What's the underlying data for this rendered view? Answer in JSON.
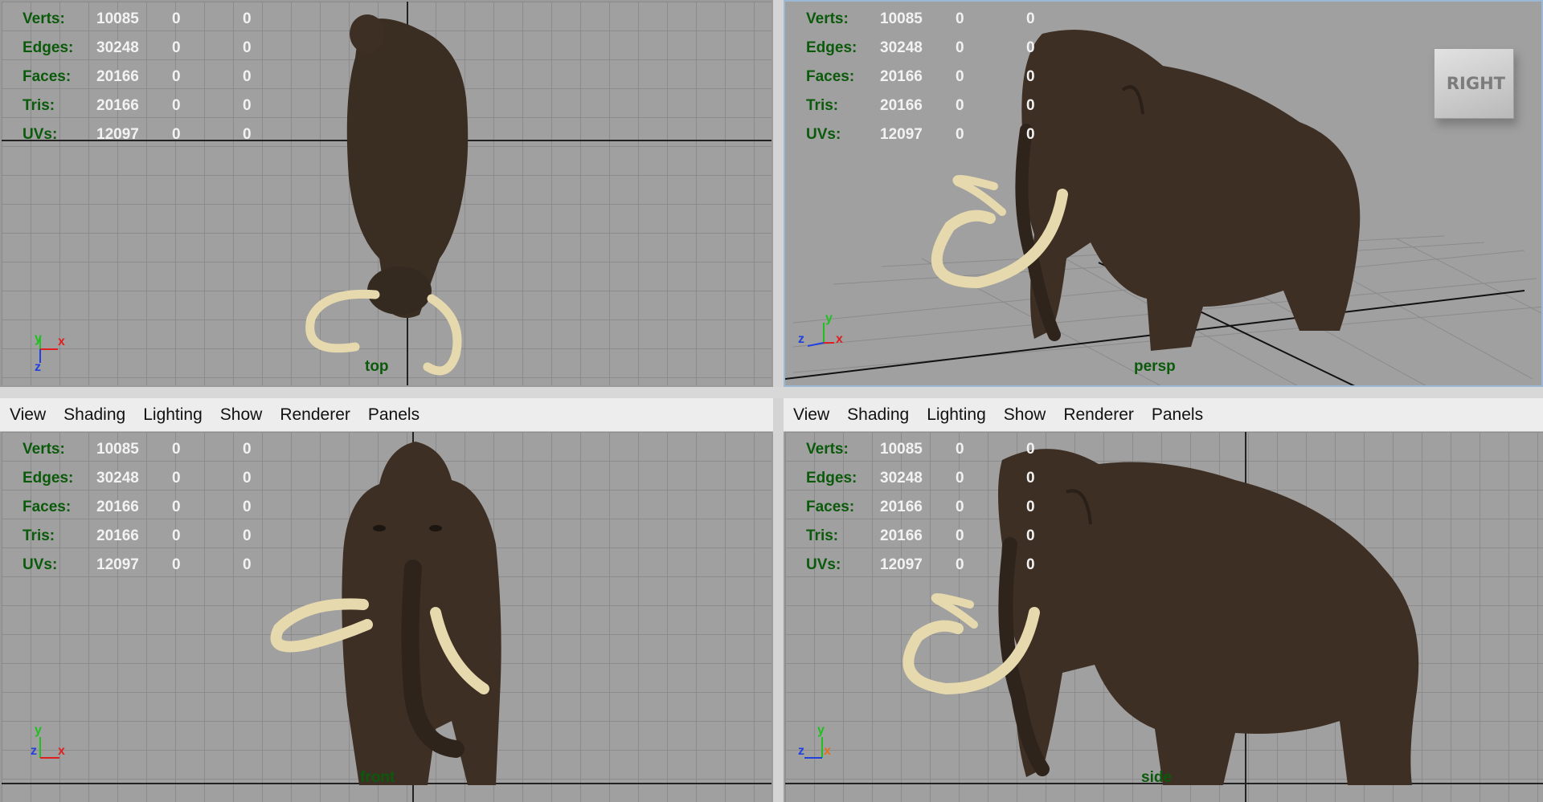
{
  "stats": {
    "labels": [
      "Verts:",
      "Edges:",
      "Faces:",
      "Tris:",
      "UVs:"
    ],
    "rows": [
      {
        "label": "Verts:",
        "v1": "10085",
        "v2": "0",
        "v3": "0"
      },
      {
        "label": "Edges:",
        "v1": "30248",
        "v2": "0",
        "v3": "0"
      },
      {
        "label": "Faces:",
        "v1": "20166",
        "v2": "0",
        "v3": "0"
      },
      {
        "label": "Tris:",
        "v1": "20166",
        "v2": "0",
        "v3": "0"
      },
      {
        "label": "UVs:",
        "v1": "12097",
        "v2": "0",
        "v3": "0"
      }
    ]
  },
  "viewports": {
    "top": {
      "camera": "top",
      "axes": {
        "a": "y",
        "b": "x",
        "c": "z"
      }
    },
    "persp": {
      "camera": "persp",
      "axes": {
        "a": "y",
        "b": "z",
        "c": "x"
      },
      "viewcube": "RIGHT"
    },
    "front": {
      "camera": "front",
      "axes": {
        "a": "y",
        "b": "z",
        "c": "x"
      }
    },
    "side": {
      "camera": "side",
      "axes": {
        "a": "y",
        "b": "z",
        "c": "x"
      }
    }
  },
  "menus": {
    "left": [
      "View",
      "Shading",
      "Lighting",
      "Show",
      "Renderer",
      "Panels"
    ],
    "right": [
      "View",
      "Shading",
      "Lighting",
      "Show",
      "Renderer",
      "Panels"
    ]
  },
  "colors": {
    "hud_label": "#0b5a0b",
    "viewport_bg": "#a0a0a0",
    "grid_line": "#8b8b8b",
    "fur": "#3e2f24",
    "tusk": "#e8dcb0",
    "axis_x": "#e02020",
    "axis_y": "#20c020",
    "axis_z": "#2040e0"
  }
}
